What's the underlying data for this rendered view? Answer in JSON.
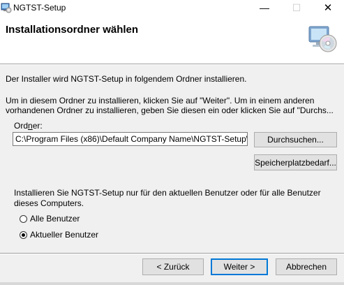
{
  "window": {
    "title": "NGTST-Setup",
    "min_glyph": "—",
    "max_glyph": "☐",
    "close_glyph": "✕"
  },
  "header": {
    "title": "Installationsordner wählen",
    "icon": "cd-computer-icon"
  },
  "body": {
    "intro": "Der Installer wird NGTST-Setup in folgendem Ordner installieren.",
    "instruction_line1": "Um in diesem Ordner zu installieren, klicken Sie auf \"Weiter\". Um in einem anderen",
    "instruction_line2": "vorhandenen Ordner zu installieren, geben Sie diesen ein oder klicken Sie auf \"Durchs...",
    "folder_label_pre": "Ord",
    "folder_label_ul": "n",
    "folder_label_post": "er:",
    "folder_value": "C:\\Program Files (x86)\\Default Company Name\\NGTST-Setup\\",
    "browse_label": "Durchsuchen...",
    "diskcost_label": "Speicherplatzbedarf...",
    "scope_line1": "Installieren Sie NGTST-Setup nur für den aktuellen Benutzer oder für alle Benutzer",
    "scope_line2": "dieses Computers.",
    "radio_all": "Alle Benutzer",
    "radio_current": "Aktueller Benutzer",
    "selected": "current"
  },
  "footer": {
    "back_label": "< Zurück",
    "next_label": "Weiter >",
    "cancel_label": "Abbrechen"
  }
}
